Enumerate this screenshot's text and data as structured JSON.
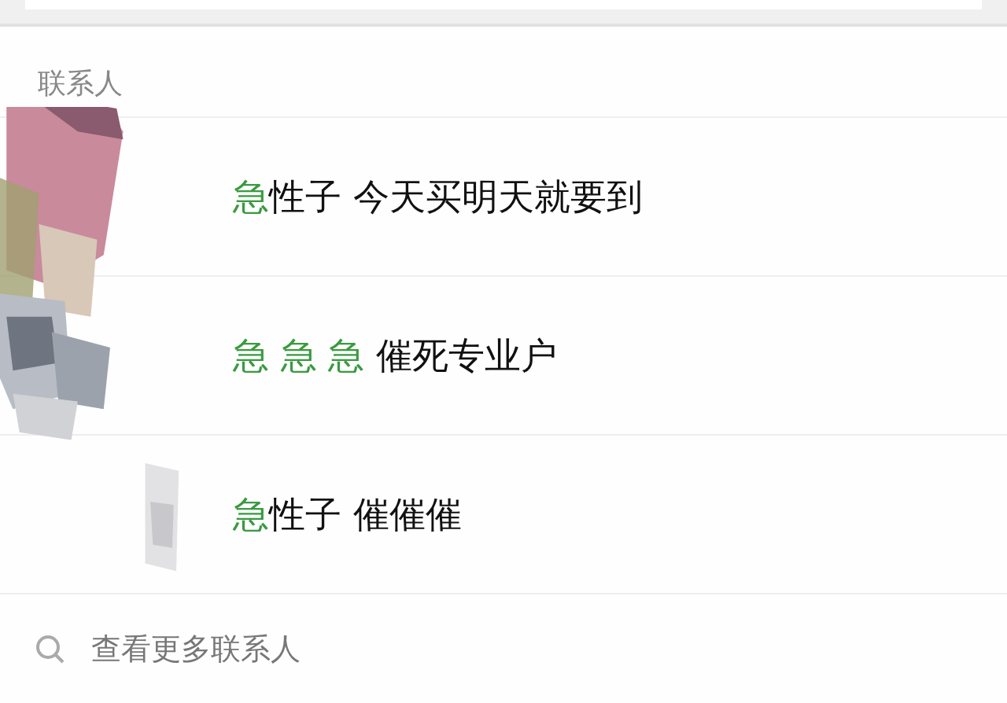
{
  "section_title": "联系人",
  "contacts": [
    {
      "name": [
        {
          "text": "急",
          "highlight": true
        },
        {
          "text": "性子 今天买明天就要到",
          "highlight": false
        }
      ]
    },
    {
      "name": [
        {
          "text": "急 急 急",
          "highlight": true
        },
        {
          "text": " 催死专业户",
          "highlight": false
        }
      ]
    },
    {
      "name": [
        {
          "text": "急",
          "highlight": true
        },
        {
          "text": "性子 催催催",
          "highlight": false
        }
      ]
    }
  ],
  "more_link": "查看更多联系人"
}
